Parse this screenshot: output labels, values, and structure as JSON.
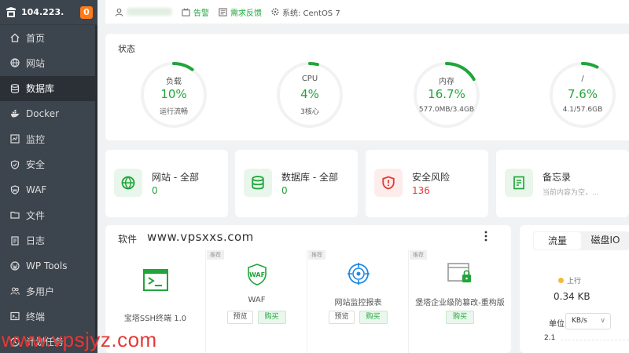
{
  "sidebar": {
    "server_ip": "104.223.",
    "notice_count": "0",
    "items": [
      {
        "label": "首页",
        "icon": "home-icon"
      },
      {
        "label": "网站",
        "icon": "globe-icon"
      },
      {
        "label": "数据库",
        "icon": "database-icon"
      },
      {
        "label": "Docker",
        "icon": "docker-icon"
      },
      {
        "label": "监控",
        "icon": "monitor-icon"
      },
      {
        "label": "安全",
        "icon": "shield-icon"
      },
      {
        "label": "WAF",
        "icon": "waf-icon"
      },
      {
        "label": "文件",
        "icon": "folder-icon"
      },
      {
        "label": "日志",
        "icon": "log-icon"
      },
      {
        "label": "WP Tools",
        "icon": "wordpress-icon"
      },
      {
        "label": "多用户",
        "icon": "users-icon"
      },
      {
        "label": "终端",
        "icon": "terminal-icon"
      },
      {
        "label": "计划任务",
        "icon": "clock-icon"
      }
    ],
    "active_index": 2
  },
  "topbar": {
    "alert_label": "告警",
    "feedback_label": "需求反馈",
    "system_label": "系统: CentOS 7"
  },
  "status": {
    "title": "状态",
    "gauges": [
      {
        "label": "负载",
        "value": "10%",
        "sub": "运行流畅",
        "percent": 10
      },
      {
        "label": "CPU",
        "value": "4%",
        "sub": "3核心",
        "percent": 4
      },
      {
        "label": "内存",
        "value": "16.7%",
        "sub": "577.0MB/3.4GB",
        "percent": 16.7
      },
      {
        "label": "/",
        "value": "7.6%",
        "sub": "4.1/57.6GB",
        "percent": 7.6
      }
    ]
  },
  "cards": [
    {
      "title": "网站 - 全部",
      "value": "0",
      "icon": "globe-icon"
    },
    {
      "title": "数据库 - 全部",
      "value": "0",
      "icon": "database-icon"
    },
    {
      "title": "安全风险",
      "value": "136",
      "icon": "shield-alert-icon"
    },
    {
      "title": "备忘录",
      "value": "当前内容为空，...",
      "icon": "memo-icon"
    }
  ],
  "software": {
    "title": "软件",
    "watermark": "www.vpsxxs.com",
    "items": [
      {
        "name": "宝塔SSH终端 1.0",
        "tag": "",
        "icon": "ssh-terminal-icon",
        "preview": "",
        "buy": ""
      },
      {
        "name": "WAF",
        "tag": "推荐",
        "icon": "waf-icon",
        "preview": "预览",
        "buy": "购买"
      },
      {
        "name": "网站监控报表",
        "tag": "推荐",
        "icon": "site-monitor-icon",
        "preview": "预览",
        "buy": "购买"
      },
      {
        "name": "堡塔企业级防篡改-重构版",
        "tag": "推荐",
        "icon": "tamper-proof-icon",
        "preview": "",
        "buy": "购买"
      }
    ]
  },
  "traffic": {
    "tabs": [
      "流量",
      "磁盘IO"
    ],
    "upload_label": "上行",
    "upload_value": "0.34 KB",
    "unit_label": "单位",
    "unit_value": "KB/s",
    "axis_value": "2.1"
  },
  "site_watermark": "www.vpsjyz.com",
  "colors": {
    "accent": "#20a53a",
    "danger": "#e53935",
    "sidebar_bg": "#3c444d",
    "sidebar_active": "#2b3037"
  }
}
